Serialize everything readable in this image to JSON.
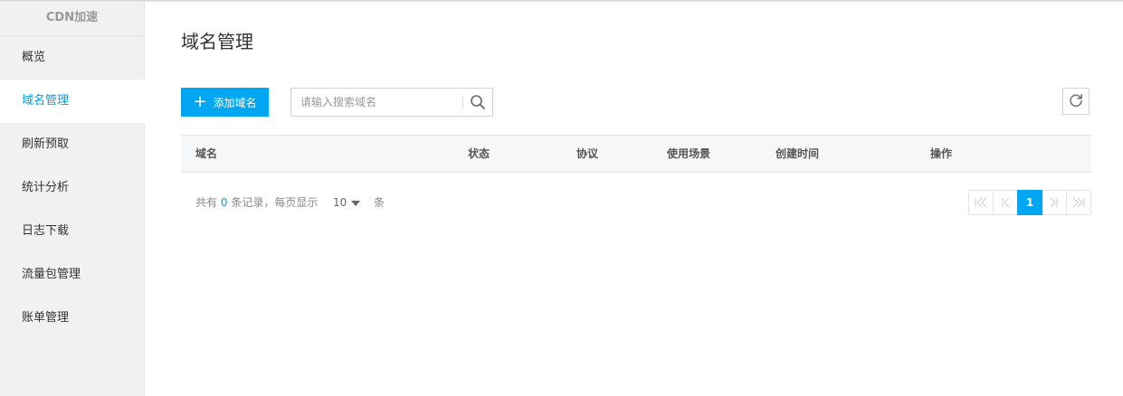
{
  "sidebar": {
    "title": "CDN加速",
    "items": [
      {
        "label": "概览"
      },
      {
        "label": "域名管理"
      },
      {
        "label": "刷新预取"
      },
      {
        "label": "统计分析"
      },
      {
        "label": "日志下载"
      },
      {
        "label": "流量包管理"
      },
      {
        "label": "账单管理"
      }
    ],
    "active_color": "#00a0e9"
  },
  "main": {
    "title": "域名管理",
    "add_button": "添加域名",
    "search": {
      "placeholder": "请输入搜索域名",
      "value": ""
    },
    "table": {
      "columns": [
        "域名",
        "状态",
        "协议",
        "使用场景",
        "创建时间",
        "操作"
      ],
      "rows": []
    },
    "footer": {
      "total_prefix": "共有",
      "total_count": "0",
      "total_suffix": "条记录，每页显示",
      "page_size": "10",
      "unit": "条"
    },
    "pagination": {
      "first": "|<<",
      "prev": "|<",
      "current": "1",
      "next": ">|",
      "last": ">>|"
    }
  },
  "colors": {
    "accent": "#00a6f2",
    "sidebar_bg": "#eff1f3"
  }
}
